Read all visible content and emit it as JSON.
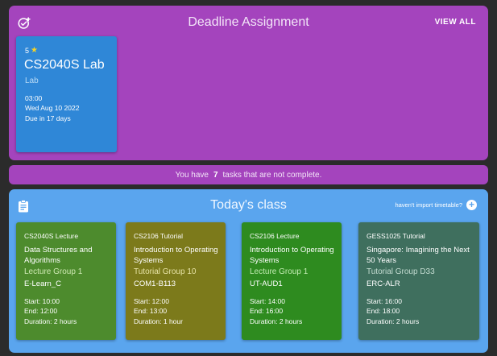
{
  "deadline": {
    "title": "Deadline Assignment",
    "view_all": "VIEW ALL",
    "icon": "check-add-icon",
    "assignment": {
      "stars": "5",
      "title": "CS2040S Lab",
      "type": "Lab",
      "time": "03:00",
      "date": "Wed Aug 10 2022",
      "due": "Due in 17 days",
      "color": "#2f87d7"
    }
  },
  "status": {
    "prefix": "You have",
    "count": "7",
    "suffix": "tasks that are not complete."
  },
  "today": {
    "title": "Today's class",
    "icon": "clipboard-icon",
    "import_text": "haven't import timetable?",
    "classes": [
      {
        "code": "CS2040S Lecture",
        "name": "Data Structures and Algorithms",
        "group": "Lecture Group 1",
        "venue": "E-Learn_C",
        "start": "Start: 10:00",
        "end": "End: 12:00",
        "duration": "Duration: 2 hours",
        "bg": "#4d8b2d",
        "group_color": "#cfe9b4"
      },
      {
        "code": "CS2106 Tutorial",
        "name": "Introduction to Operating Systems",
        "group": "Tutorial Group 10",
        "venue": "COM1-B113",
        "start": "Start: 12:00",
        "end": "End: 13:00",
        "duration": "Duration: 1 hour",
        "bg": "#7c7a1b",
        "group_color": "#e8e4a7"
      },
      {
        "code": "CS2106 Lecture",
        "name": "Introduction to Operating Systems",
        "group": "Lecture Group 1",
        "venue": "UT-AUD1",
        "start": "Start: 14:00",
        "end": "End: 16:00",
        "duration": "Duration: 2 hours",
        "bg": "#2e8b1f",
        "group_color": "#c3ecb3"
      },
      {
        "code": "GESS1025 Tutorial",
        "name": "Singapore: Imagining the Next 50 Years",
        "group": "Tutorial Group D33",
        "venue": "ERC-ALR",
        "start": "Start: 16:00",
        "end": "End: 18:00",
        "duration": "Duration: 2 hours",
        "bg": "#3f6f5e",
        "group_color": "#c4dcd1"
      }
    ]
  }
}
